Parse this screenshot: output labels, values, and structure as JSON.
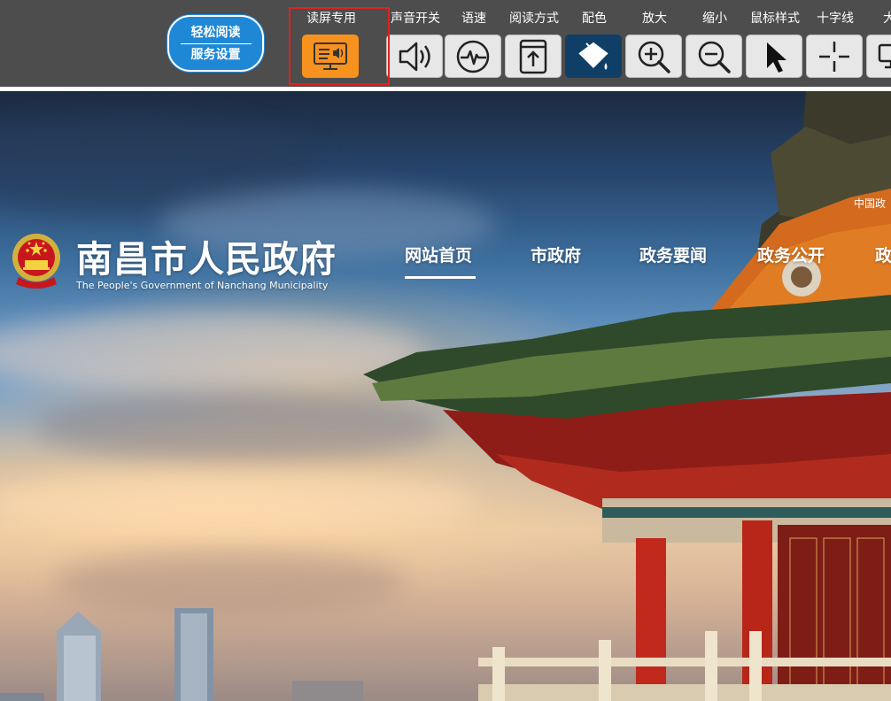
{
  "toolbar": {
    "settings_line1": "轻松阅读",
    "settings_line2": "服务设置",
    "tools": [
      {
        "label": "读屏专用",
        "icon": "screen-reader-icon"
      },
      {
        "label": "声音开关",
        "icon": "speaker-icon"
      },
      {
        "label": "语速",
        "icon": "speech-speed-icon"
      },
      {
        "label": "阅读方式",
        "icon": "reading-mode-icon"
      },
      {
        "label": "配色",
        "icon": "color-bucket-icon"
      },
      {
        "label": "放大",
        "icon": "zoom-in-icon"
      },
      {
        "label": "缩小",
        "icon": "zoom-out-icon"
      },
      {
        "label": "鼠标样式",
        "icon": "cursor-icon"
      },
      {
        "label": "十字线",
        "icon": "crosshair-icon"
      },
      {
        "label": "大字",
        "icon": "large-text-icon"
      }
    ],
    "active_color": "#f7921e",
    "highlight_color": "#e3211c"
  },
  "header": {
    "title": "南昌市人民政府",
    "subtitle": "The People's Government of Nanchang Municipality",
    "top_link": "中国政",
    "nav": [
      {
        "label": "网站首页"
      },
      {
        "label": "市政府"
      },
      {
        "label": "政务要闻"
      },
      {
        "label": "政务公开"
      },
      {
        "label": "政"
      }
    ]
  }
}
